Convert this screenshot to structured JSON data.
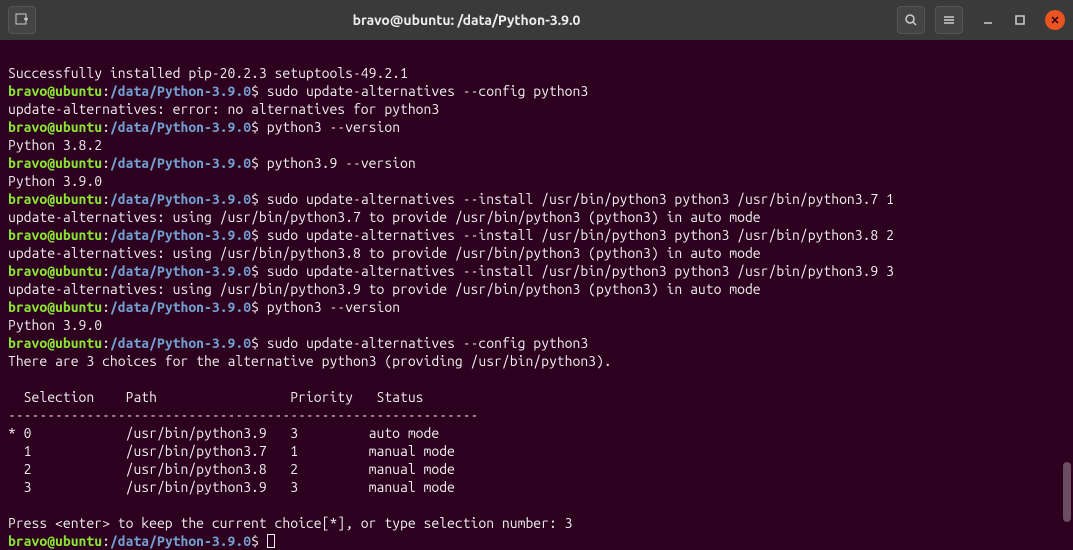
{
  "titlebar": {
    "title": "bravo@ubuntu: /data/Python-3.9.0"
  },
  "prompt": {
    "user": "bravo@ubuntu",
    "colon": ":",
    "path": "/data/Python-3.9.0",
    "suffix": "$"
  },
  "lines": {
    "l0": "Successfully installed pip-20.2.3 setuptools-49.2.1",
    "cmd1": "sudo update-alternatives --config python3",
    "l2": "update-alternatives: error: no alternatives for python3",
    "cmd3": "python3 --version",
    "l4": "Python 3.8.2",
    "cmd5": "python3.9 --version",
    "l6": "Python 3.9.0",
    "cmd7": "sudo update-alternatives --install /usr/bin/python3 python3 /usr/bin/python3.7 1",
    "l8": "update-alternatives: using /usr/bin/python3.7 to provide /usr/bin/python3 (python3) in auto mode",
    "cmd9": "sudo update-alternatives --install /usr/bin/python3 python3 /usr/bin/python3.8 2",
    "l10": "update-alternatives: using /usr/bin/python3.8 to provide /usr/bin/python3 (python3) in auto mode",
    "cmd11": "sudo update-alternatives --install /usr/bin/python3 python3 /usr/bin/python3.9 3",
    "l12": "update-alternatives: using /usr/bin/python3.9 to provide /usr/bin/python3 (python3) in auto mode",
    "cmd13": "python3 --version",
    "l14": "Python 3.9.0",
    "cmd15": "sudo update-alternatives --config python3",
    "l16": "There are 3 choices for the alternative python3 (providing /usr/bin/python3).",
    "l17": "",
    "header": "  Selection    Path                 Priority   Status",
    "sep": "------------------------------------------------------------",
    "r0": "* 0            /usr/bin/python3.9   3         auto mode",
    "r1": "  1            /usr/bin/python3.7   1         manual mode",
    "r2": "  2            /usr/bin/python3.8   2         manual mode",
    "r3": "  3            /usr/bin/python3.9   3         manual mode",
    "l18": "",
    "pressenter": "Press <enter> to keep the current choice[*], or type selection number: 3"
  }
}
